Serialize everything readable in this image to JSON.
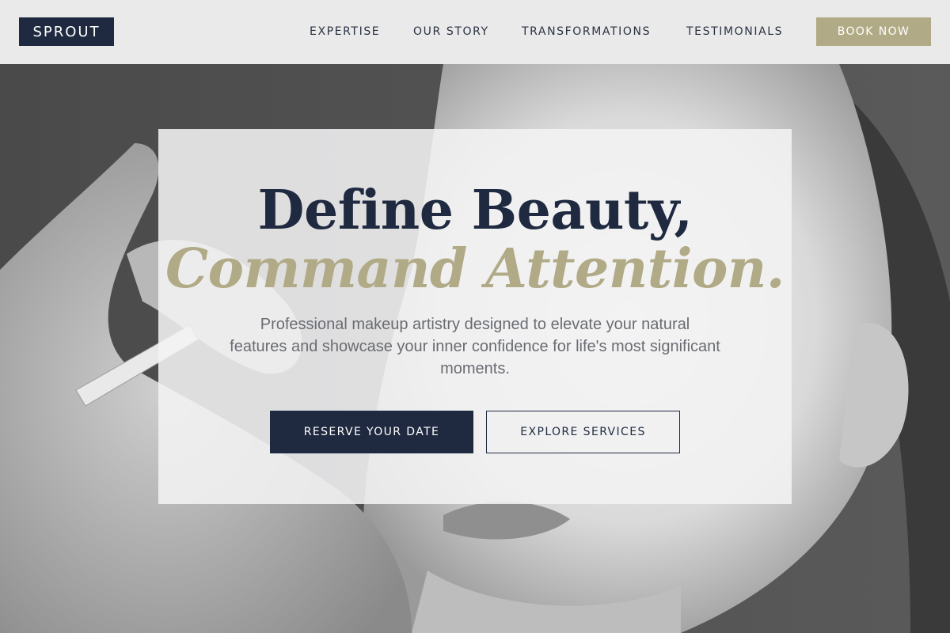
{
  "header": {
    "logo": "SPROUT",
    "nav": [
      {
        "label": "EXPERTISE"
      },
      {
        "label": "OUR STORY"
      },
      {
        "label": "TRANSFORMATIONS"
      },
      {
        "label": "TESTIMONIALS"
      }
    ],
    "book_label": "BOOK NOW"
  },
  "hero": {
    "headline_line1": "Define Beauty,",
    "headline_line2": "Command Attention.",
    "subtitle": "Professional makeup artistry designed to elevate your natural features and showcase your inner confidence for life's most significant moments.",
    "primary_button": "RESERVE YOUR DATE",
    "secondary_button": "EXPLORE SERVICES"
  },
  "colors": {
    "navy": "#1f2a40",
    "gold": "#b1aa86",
    "header_bg": "#efeff0"
  }
}
